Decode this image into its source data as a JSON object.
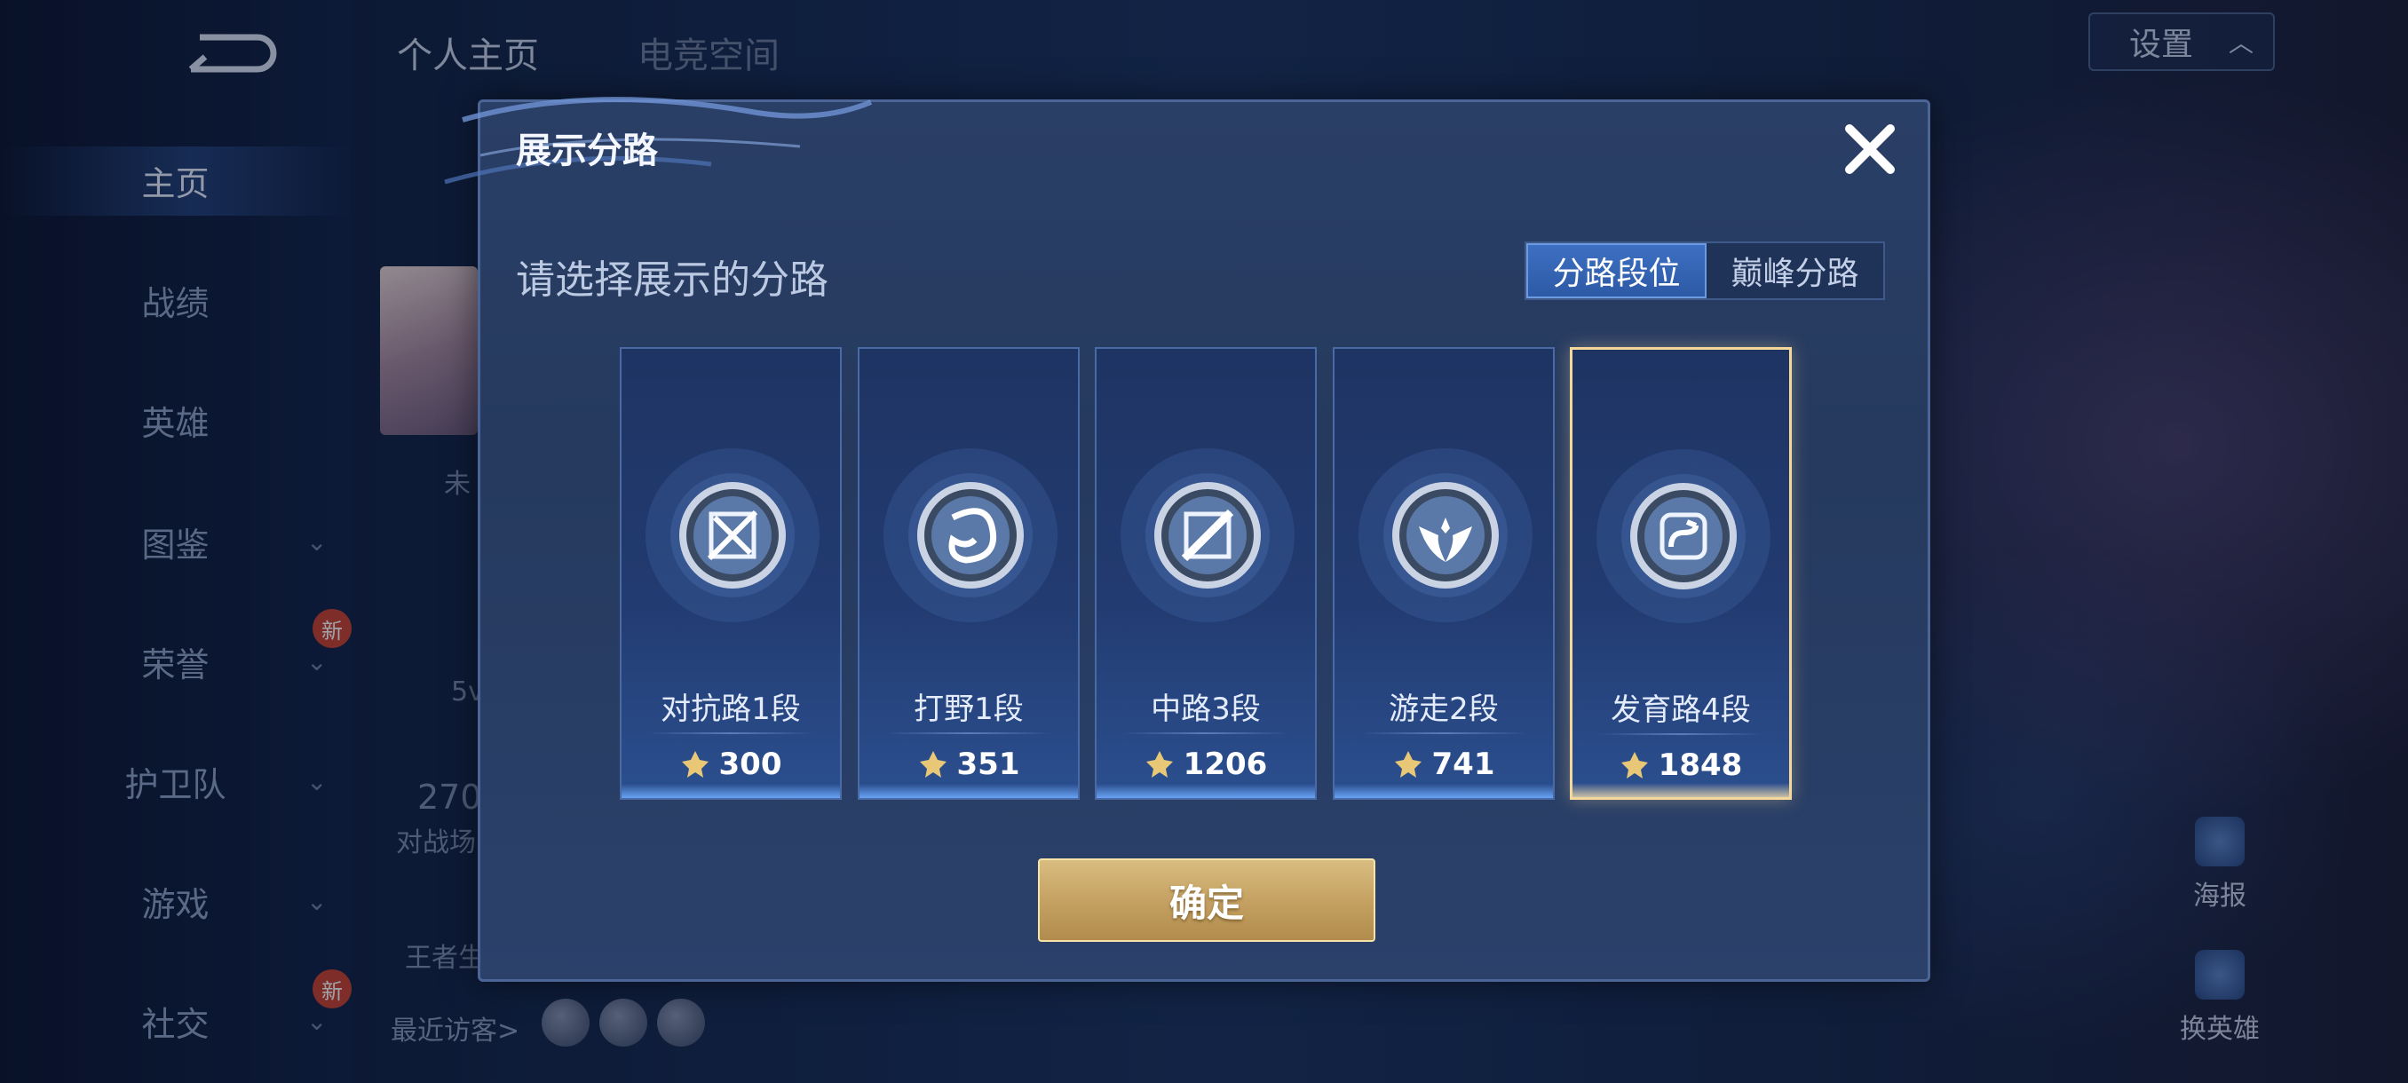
{
  "nav": {
    "items": [
      {
        "label": "主页",
        "active": true
      },
      {
        "label": "战绩"
      },
      {
        "label": "英雄"
      },
      {
        "label": "图鉴",
        "chevron": "chevron-down-icon"
      },
      {
        "label": "荣誉",
        "chevron": "chevron-down-icon",
        "badge": "新"
      },
      {
        "label": "护卫队",
        "chevron": "chevron-down-icon"
      },
      {
        "label": "游戏",
        "chevron": "chevron-down-icon"
      },
      {
        "label": "社交",
        "chevron": "chevron-down-icon",
        "badge": "新"
      }
    ]
  },
  "header": {
    "tabs": [
      {
        "label": "个人主页"
      },
      {
        "label": "电竞空间"
      }
    ],
    "settings_label": "设置"
  },
  "background": {
    "status_fragment": "未",
    "level_fragment": "5v",
    "count_fragment": "270",
    "count_label_fragment": "对战场",
    "bottom_label_fragment": "王者生",
    "recent_visitors": "最近访客>",
    "poster_label": "海报",
    "change_hero_label": "换英雄"
  },
  "modal": {
    "title": "展示分路",
    "subtitle": "请选择展示的分路",
    "segment": {
      "options": [
        "分路段位",
        "巅峰分路"
      ],
      "selected": "分路段位"
    },
    "lanes": [
      {
        "name": "对抗路1段",
        "score": "300",
        "icon": "sword-emblem-icon"
      },
      {
        "name": "打野1段",
        "score": "351",
        "icon": "dragon-emblem-icon"
      },
      {
        "name": "中路3段",
        "score": "1206",
        "icon": "staff-emblem-icon"
      },
      {
        "name": "游走2段",
        "score": "741",
        "icon": "wings-emblem-icon"
      },
      {
        "name": "发育路4段",
        "score": "1848",
        "icon": "arrow-emblem-icon",
        "selected": true
      }
    ],
    "confirm_label": "确定"
  },
  "colors": {
    "accent_blue": "#3d6fc2",
    "selected_gold": "#f3d79b",
    "confirm_gold": "#c5a263"
  }
}
